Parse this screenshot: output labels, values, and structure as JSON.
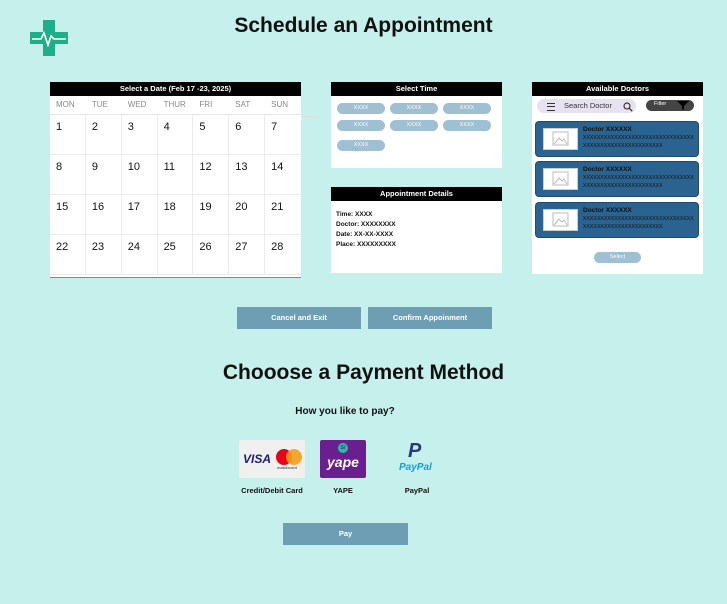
{
  "page": {
    "title": "Schedule an Appointment"
  },
  "calendar": {
    "header": "Select a Date (Feb 17 -23, 2025)",
    "days": [
      "MON",
      "TUE",
      "WED",
      "THUR",
      "FRI",
      "SAT",
      "SUN"
    ],
    "dates": [
      "1",
      "2",
      "3",
      "4",
      "5",
      "6",
      "7",
      "8",
      "9",
      "10",
      "11",
      "12",
      "13",
      "14",
      "15",
      "16",
      "17",
      "18",
      "19",
      "20",
      "21",
      "22",
      "23",
      "24",
      "25",
      "26",
      "27",
      "28"
    ]
  },
  "time": {
    "header": "Select Time",
    "slots": [
      "XXXX",
      "XXXX",
      "XXXX",
      "XXXX",
      "XXXX",
      "XXXX",
      "XXXX"
    ]
  },
  "details": {
    "header": "Appointment Details",
    "time": "Time: XXXX",
    "doctor": "Doctor: XXXXXXXX",
    "date": "Date: XX-XX-XXXX",
    "place": "Place: XXXXXXXXX"
  },
  "doctors": {
    "header": "Available Doctors",
    "search_label": "Search Doctor",
    "filter_label": "Filter",
    "items": [
      {
        "name": "Doctor XXXXXX",
        "desc": "XXXXXXXXXXXXXXXXXXXXXXXXXXXXXXXXXXXXXXXXXXXXXXXXXXXXXXX"
      },
      {
        "name": "Doctor XXXXXX",
        "desc": "XXXXXXXXXXXXXXXXXXXXXXXXXXXXXXXXXXXXXXXXXXXXXXXXXXXXXXX"
      },
      {
        "name": "Doctor XXXXXX",
        "desc": "XXXXXXXXXXXXXXXXXXXXXXXXXXXXXXXXXXXXXXXXXXXXXXXXXXXXXXX"
      }
    ],
    "select_label": "Select"
  },
  "actions": {
    "cancel": "Cancel and Exit",
    "confirm": "Confirm Appoinment"
  },
  "payment": {
    "title": "Chooose a Payment Method",
    "question": "How you like to pay?",
    "methods": [
      {
        "label": "Credit/Debit Card",
        "logo_text": "VISA",
        "sub_text": "mastercard"
      },
      {
        "label": "YAPE",
        "logo_text": "yape",
        "sub_text": "S/"
      },
      {
        "label": "PayPal",
        "logo_text": "PayPal",
        "sub_text": "P"
      }
    ],
    "pay_label": "Pay"
  },
  "colors": {
    "background": "#c6f0ec",
    "button": "#6e9eb4",
    "doctor_card": "#2b6390",
    "slot": "#9fbfd2",
    "logo": "#1fae8a"
  }
}
